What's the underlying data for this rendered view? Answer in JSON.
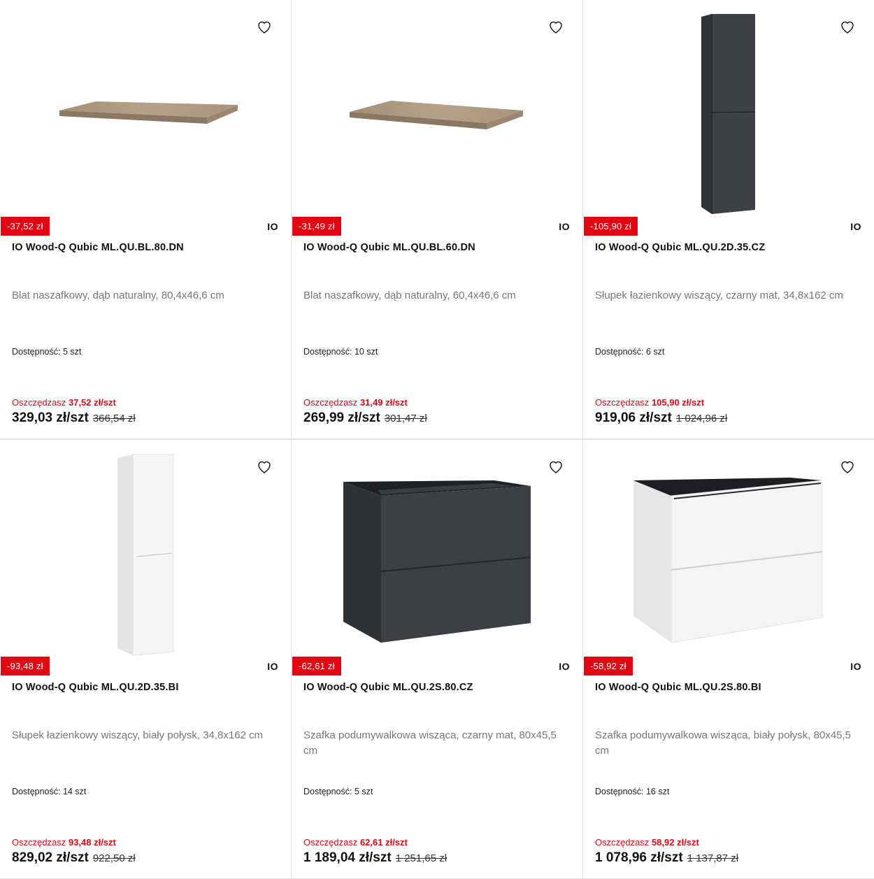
{
  "products": [
    {
      "discount": "-37,52 zł",
      "brand": "IO",
      "name": "IO Wood-Q Qubic ML.QU.BL.80.DN",
      "desc": "Blat naszafkowy, dąb naturalny, 80,4x46,6 cm",
      "stock_label": "Dostępność:",
      "stock": "5 szt",
      "save_label": "Oszczędzasz",
      "save_value": "37,52 zł/szt",
      "price": "329,03 zł/szt",
      "old_price": "366,54 zł",
      "image": "oak-countertop"
    },
    {
      "discount": "-31,49 zł",
      "brand": "IO",
      "name": "IO Wood-Q Qubic ML.QU.BL.60.DN",
      "desc": "Blat naszafkowy, dąb naturalny, 60,4x46,6 cm",
      "stock_label": "Dostępność:",
      "stock": "10 szt",
      "save_label": "Oszczędzasz",
      "save_value": "31,49 zł/szt",
      "price": "269,99 zł/szt",
      "old_price": "301,47 zł",
      "image": "oak-countertop"
    },
    {
      "discount": "-105,90 zł",
      "brand": "IO",
      "name": "IO Wood-Q Qubic ML.QU.2D.35.CZ",
      "desc": "Słupek łazienkowy wiszący, czarny mat, 34,8x162 cm",
      "stock_label": "Dostępność:",
      "stock": "6 szt",
      "save_label": "Oszczędzasz",
      "save_value": "105,90 zł/szt",
      "price": "919,06 zł/szt",
      "old_price": "1 024,96 zł",
      "image": "tall-cabinet-black"
    },
    {
      "discount": "-93,48 zł",
      "brand": "IO",
      "name": "IO Wood-Q Qubic ML.QU.2D.35.BI",
      "desc": "Słupek łazienkowy wiszący, biały połysk, 34,8x162 cm",
      "stock_label": "Dostępność:",
      "stock": "14 szt",
      "save_label": "Oszczędzasz",
      "save_value": "93,48 zł/szt",
      "price": "829,02 zł/szt",
      "old_price": "922,50 zł",
      "image": "tall-cabinet-white"
    },
    {
      "discount": "-62,61 zł",
      "brand": "IO",
      "name": "IO Wood-Q Qubic ML.QU.2S.80.CZ",
      "desc": "Szafka podumywalkowa wisząca, czarny mat, 80x45,5 cm",
      "stock_label": "Dostępność:",
      "stock": "5 szt",
      "save_label": "Oszczędzasz",
      "save_value": "62,61 zł/szt",
      "price": "1 189,04 zł/szt",
      "old_price": "1 251,65 zł",
      "image": "vanity-black"
    },
    {
      "discount": "-58,92 zł",
      "brand": "IO",
      "name": "IO Wood-Q Qubic ML.QU.2S.80.BI",
      "desc": "Szafka podumywalkowa wisząca, biały połysk, 80x45,5 cm",
      "stock_label": "Dostępność:",
      "stock": "16 szt",
      "save_label": "Oszczędzasz",
      "save_value": "58,92 zł/szt",
      "price": "1 078,96 zł/szt",
      "old_price": "1 137,87 zł",
      "image": "vanity-white"
    }
  ],
  "colors": {
    "accent": "#e30613",
    "desc_text": "#777777"
  },
  "icons": {
    "favorite": "heart-outline-icon"
  }
}
